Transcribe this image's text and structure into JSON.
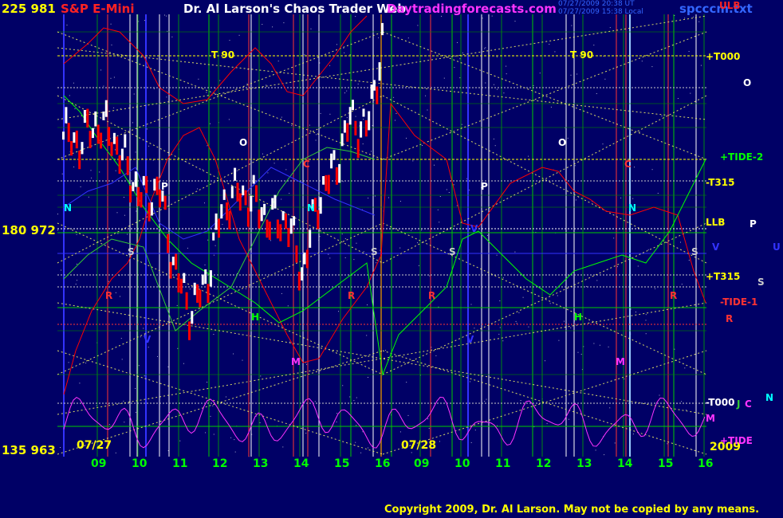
{
  "header": {
    "left_price_high": "225  981",
    "symbol": "S&P E-Mini",
    "title": "Dr. Al Larson's Chaos Trader Web",
    "site": "Daytradingforecasts.com",
    "stamp_line1": "07/27/2009 20:38 UT",
    "stamp_line2": "07/27/2009 15:38 Local",
    "file": "spcccm.txt",
    "ulb": "ULB"
  },
  "axis": {
    "price_mid": "180  972",
    "price_low": "135  963",
    "year": "2009",
    "day1": "07/27",
    "day2": "07/28",
    "hours": [
      "09",
      "10",
      "11",
      "12",
      "13",
      "14",
      "15",
      "16",
      "09",
      "10",
      "11",
      "12",
      "13",
      "14",
      "15",
      "16"
    ]
  },
  "right_labels": [
    "+T000",
    "O",
    "+TIDE-2",
    "-T315",
    "LLB",
    "P",
    "V",
    "U",
    "+T315",
    "S",
    "-TIDE-1",
    "R",
    "-T000",
    "J",
    "C",
    "N",
    "M",
    "+TIDE"
  ],
  "chart_markers": [
    "T  90",
    "T  90",
    "O",
    "O",
    "P",
    "P",
    "N",
    "N",
    "N",
    "S",
    "S",
    "S",
    "S",
    "C",
    "C",
    "R",
    "R",
    "R",
    "R",
    "H",
    "H",
    "M",
    "M",
    "V",
    "V",
    "V"
  ],
  "colors": {
    "background": "#000066",
    "price_up": "#ffffff",
    "price_down": "#ff0000",
    "green_line": "#00ff00",
    "red_line": "#ff0000",
    "yellow_grid": "#ffff00",
    "magenta_tide": "#ff33ff",
    "blue_line": "#3333ff",
    "label_yellow": "#ffff00",
    "label_magenta": "#ff33ff",
    "label_cyan": "#00ffff"
  },
  "footer": {
    "copyright": "Copyright 2009, Dr. Al Larson. May not be copied by any means."
  },
  "chart_data": {
    "type": "line",
    "price_scale": {
      "high": 981,
      "mid": 972,
      "low": 963
    },
    "x_labels": [
      "09",
      "10",
      "11",
      "12",
      "13",
      "14",
      "15",
      "16",
      "09",
      "10",
      "11",
      "12",
      "13",
      "14",
      "15",
      "16"
    ],
    "series": [
      {
        "name": "price",
        "values": [
          975.9,
          975.6,
          976.4,
          976.0,
          974.5,
          973.2,
          973.7,
          970.2,
          968.5,
          969.8,
          973.0,
          973.5,
          973.1,
          972.3,
          972.4,
          970.1,
          973.3,
          974.5,
          976.6,
          976.1,
          979.7
        ]
      }
    ]
  }
}
